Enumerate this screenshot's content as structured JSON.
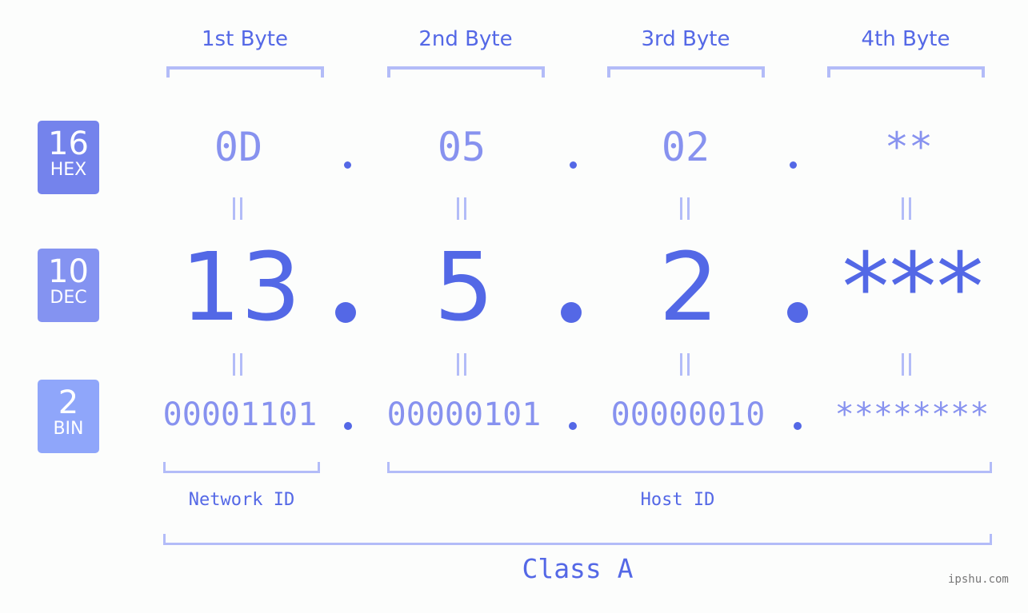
{
  "headers": [
    "1st Byte",
    "2nd Byte",
    "3rd Byte",
    "4th Byte"
  ],
  "badges": [
    {
      "number": "16",
      "label": "HEX",
      "color": "#7483ec"
    },
    {
      "number": "10",
      "label": "DEC",
      "color": "#8493f1"
    },
    {
      "number": "2",
      "label": "BIN",
      "color": "#8fa6fa"
    }
  ],
  "hex": [
    "0D",
    "05",
    "02",
    "**"
  ],
  "dec": [
    "13",
    "5",
    "2",
    "***"
  ],
  "bin": [
    "00001101",
    "00000101",
    "00000010",
    "********"
  ],
  "separator": ".",
  "network_label": "Network ID",
  "host_label": "Host ID",
  "class_label": "Class A",
  "watermark": "ipshu.com",
  "colors": {
    "accent": "#5468e6",
    "light_value": "#8792ef",
    "bracket": "#b3bcf8",
    "background": "#fcfdfc"
  }
}
